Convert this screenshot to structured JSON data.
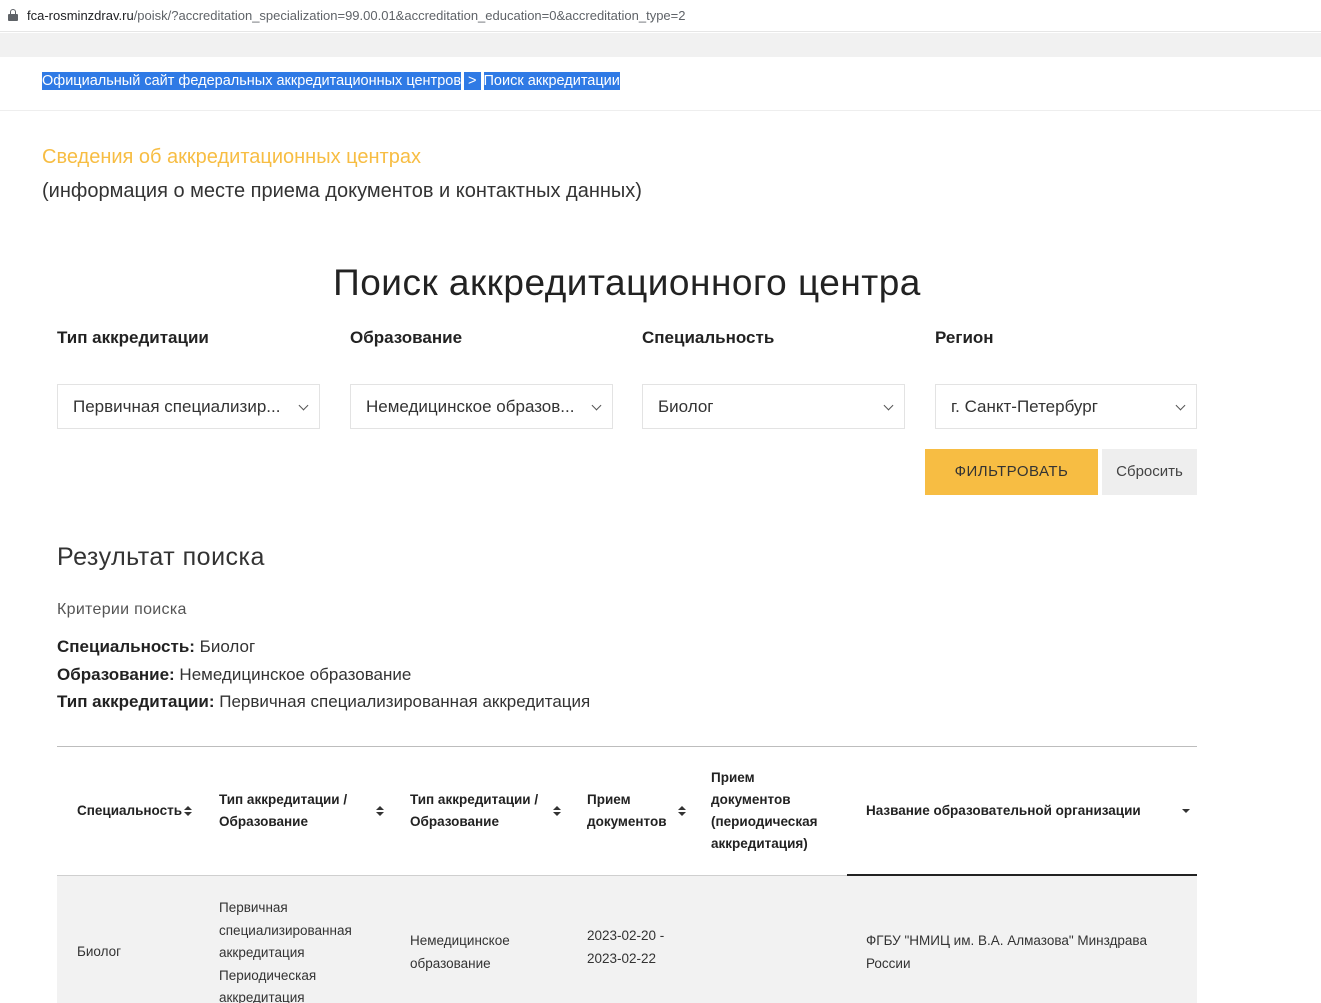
{
  "browser": {
    "url_host": "fca-rosminzdrav.ru",
    "url_path": "/poisk/?accreditation_specialization=99.00.01&accreditation_education=0&accreditation_type=2"
  },
  "breadcrumb": {
    "home": "Официальный сайт федеральных аккредитационных центров",
    "separator": ">",
    "current": "Поиск аккредитации"
  },
  "info": {
    "title": "Сведения об аккредитационных центрах",
    "subtitle": "(информация о месте приема документов и контактных данных)"
  },
  "search": {
    "title": "Поиск аккредитационного центра",
    "filters": [
      {
        "label": "Тип аккредитации",
        "value": "Первичная специализир..."
      },
      {
        "label": "Образование",
        "value": "Немедицинское образов..."
      },
      {
        "label": "Специальность",
        "value": "Биолог"
      },
      {
        "label": "Регион",
        "value": "г. Санкт-Петербург"
      }
    ],
    "filter_button": "ФИЛЬТРОВАТЬ",
    "reset_button": "Сбросить"
  },
  "results": {
    "title": "Результат поиска",
    "criteria_title": "Критерии поиска",
    "criteria": [
      {
        "label": "Специальность:",
        "value": " Биолог"
      },
      {
        "label": "Образование:",
        "value": " Немедицинское образование"
      },
      {
        "label": "Тип аккредитации:",
        "value": " Первичная специализированная аккредитация"
      }
    ]
  },
  "table": {
    "headers": [
      "Специальность",
      "Тип аккредитации / Образование",
      "Тип аккредитации / Образование",
      "Прием документов",
      "Прием документов (периодическая аккредитация)",
      "Название образовательной организации"
    ],
    "row": {
      "specialty": "Биолог",
      "accreditation_type_lines": [
        "Первичная",
        "специализированная",
        "аккредитация",
        "Периодическая",
        "аккредитация"
      ],
      "education_lines": [
        "Немедицинское",
        "образование"
      ],
      "dates_lines": [
        "2023-02-20 -",
        "2023-02-22"
      ],
      "periodic": "",
      "organization_lines": [
        "ФГБУ \"НМИЦ им. В.А. Алмазова\" Минздрава",
        "России"
      ]
    }
  },
  "colors": {
    "accent": "#f7bd43",
    "selection": "#2f7ae5"
  }
}
